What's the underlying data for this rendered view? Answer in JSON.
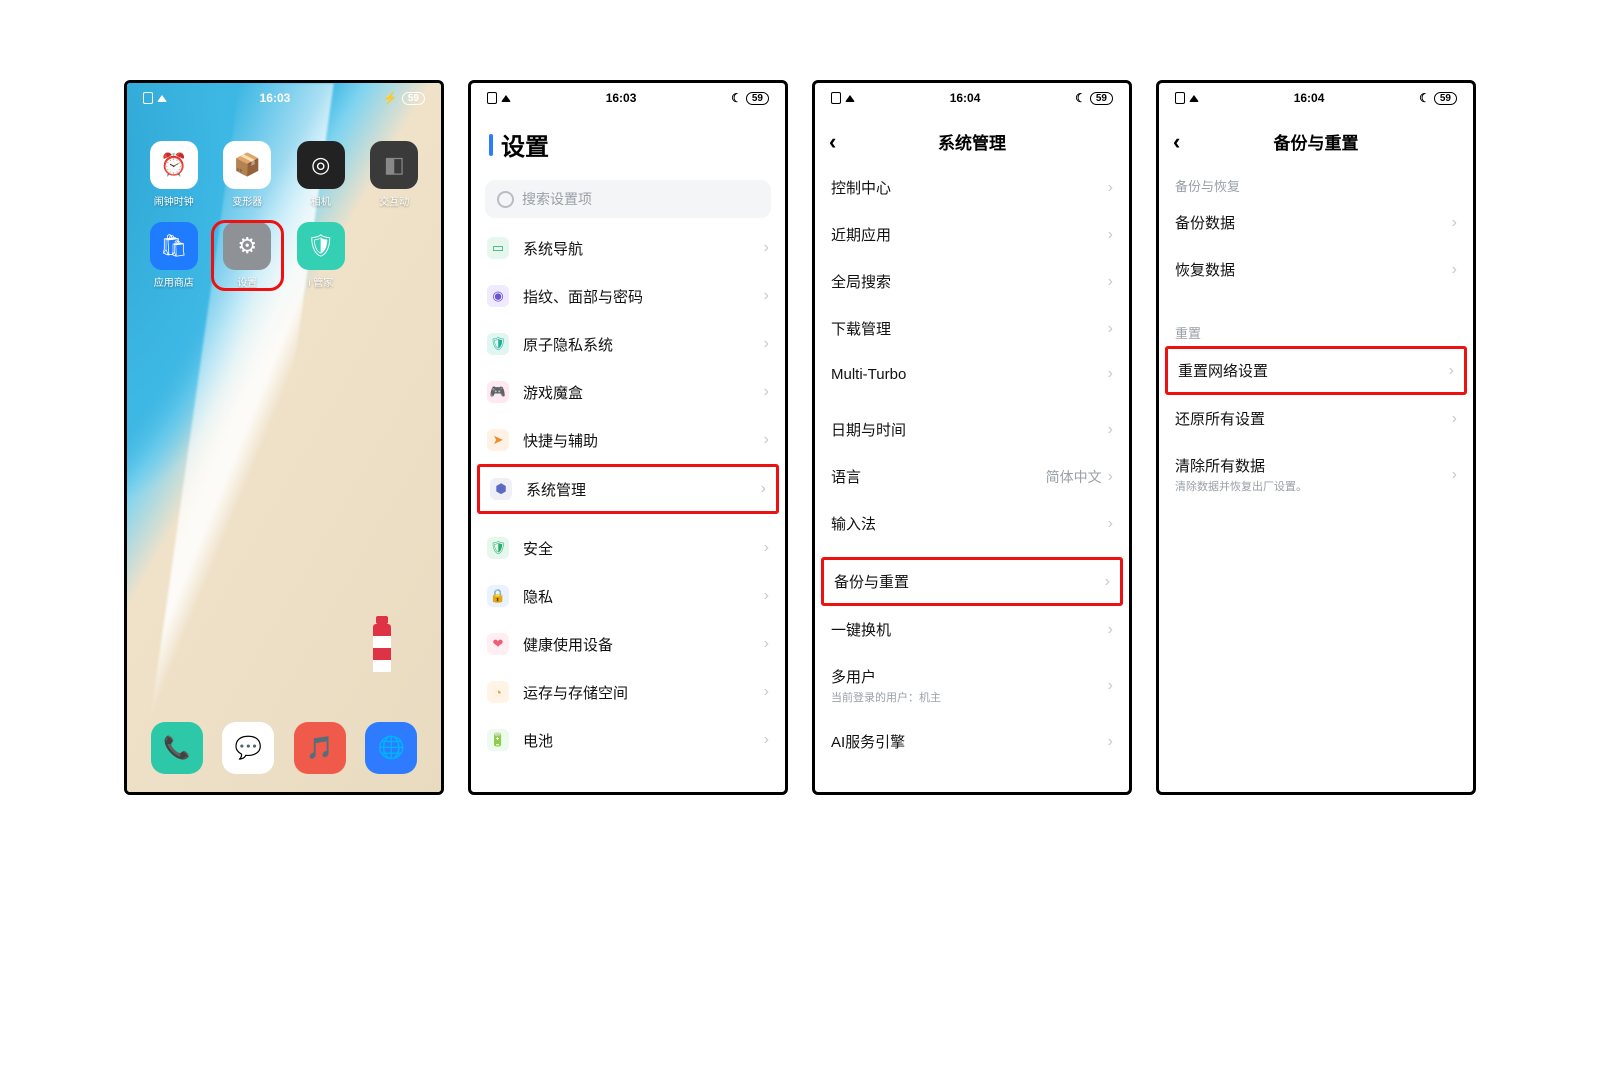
{
  "statusbar": {
    "time1": "16:03",
    "time2": "16:03",
    "time3": "16:04",
    "time4": "16:04",
    "battery": "59"
  },
  "home": {
    "apps": [
      {
        "label": "闹钟时钟",
        "color": "#fff"
      },
      {
        "label": "变形器",
        "color": "#fff"
      },
      {
        "label": "相机",
        "color": "#222"
      },
      {
        "label": "交互动",
        "color": "#3a3a3a"
      },
      {
        "label": "应用商店",
        "color": "#1f7cff"
      },
      {
        "label": "设置",
        "color": "#8e9196"
      },
      {
        "label": "i 管家",
        "color": "#34d0b3"
      }
    ],
    "dock": [
      {
        "color": "#2dc8a8"
      },
      {
        "color": "#fff"
      },
      {
        "color": "#f05a4a"
      },
      {
        "color": "#2f7bff"
      }
    ]
  },
  "screen2": {
    "title": "设置",
    "search_placeholder": "搜索设置项",
    "group1": [
      {
        "label": "系统导航",
        "ic": "c-green"
      },
      {
        "label": "指纹、面部与密码",
        "ic": "c-purple"
      },
      {
        "label": "原子隐私系统",
        "ic": "c-teal"
      },
      {
        "label": "游戏魔盒",
        "ic": "c-pink"
      },
      {
        "label": "快捷与辅助",
        "ic": "c-orange"
      },
      {
        "label": "系统管理",
        "ic": "c-slate",
        "hl": true
      }
    ],
    "group2": [
      {
        "label": "安全",
        "ic": "c-green"
      },
      {
        "label": "隐私",
        "ic": "c-lock"
      },
      {
        "label": "健康使用设备",
        "ic": "c-heart"
      },
      {
        "label": "运存与存储空间",
        "ic": "c-store"
      },
      {
        "label": "电池",
        "ic": "c-batt"
      }
    ]
  },
  "screen3": {
    "title": "系统管理",
    "group1": [
      "控制中心",
      "近期应用",
      "全局搜索",
      "下载管理",
      "Multi-Turbo"
    ],
    "group2": [
      {
        "label": "日期与时间"
      },
      {
        "label": "语言",
        "value": "简体中文"
      },
      {
        "label": "输入法"
      }
    ],
    "group3": [
      {
        "label": "备份与重置",
        "hl": true
      },
      {
        "label": "一键换机"
      },
      {
        "label": "多用户",
        "sub": "当前登录的用户：机主"
      },
      {
        "label": "AI服务引擎"
      }
    ]
  },
  "screen4": {
    "title": "备份与重置",
    "sec1_label": "备份与恢复",
    "sec1": [
      "备份数据",
      "恢复数据"
    ],
    "sec2_label": "重置",
    "sec2": [
      {
        "label": "重置网络设置",
        "hl": true
      },
      {
        "label": "还原所有设置"
      },
      {
        "label": "清除所有数据",
        "sub": "清除数据并恢复出厂设置。"
      }
    ]
  }
}
